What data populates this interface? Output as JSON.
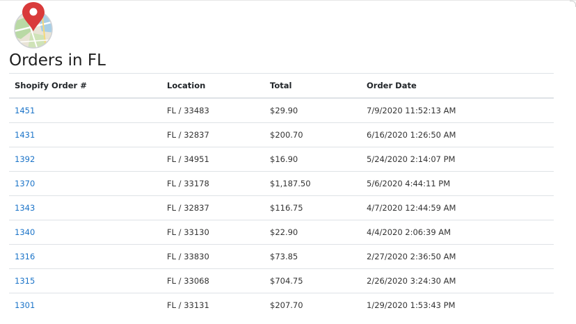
{
  "header": {
    "title": "Orders in FL"
  },
  "table": {
    "columns": [
      "Shopify Order #",
      "Location",
      "Total",
      "Order Date"
    ],
    "rows": [
      {
        "order": "1451",
        "location": "FL / 33483",
        "total": "$29.90",
        "date": "7/9/2020 11:52:13 AM"
      },
      {
        "order": "1431",
        "location": "FL / 32837",
        "total": "$200.70",
        "date": "6/16/2020 1:26:50 AM"
      },
      {
        "order": "1392",
        "location": "FL / 34951",
        "total": "$16.90",
        "date": "5/24/2020 2:14:07 PM"
      },
      {
        "order": "1370",
        "location": "FL / 33178",
        "total": "$1,187.50",
        "date": "5/6/2020 4:44:11 PM"
      },
      {
        "order": "1343",
        "location": "FL / 32837",
        "total": "$116.75",
        "date": "4/7/2020 12:44:59 AM"
      },
      {
        "order": "1340",
        "location": "FL / 33130",
        "total": "$22.90",
        "date": "4/4/2020 2:06:39 AM"
      },
      {
        "order": "1316",
        "location": "FL / 33830",
        "total": "$73.85",
        "date": "2/27/2020 2:36:50 AM"
      },
      {
        "order": "1315",
        "location": "FL / 33068",
        "total": "$704.75",
        "date": "2/26/2020 3:24:30 AM"
      },
      {
        "order": "1301",
        "location": "FL / 33131",
        "total": "$207.70",
        "date": "1/29/2020 1:53:43 PM"
      }
    ]
  },
  "colors": {
    "link": "#1a73c8",
    "pin": "#d93a3a",
    "border": "#dee2e6"
  },
  "icons": {
    "logo": "map-pin-icon"
  }
}
